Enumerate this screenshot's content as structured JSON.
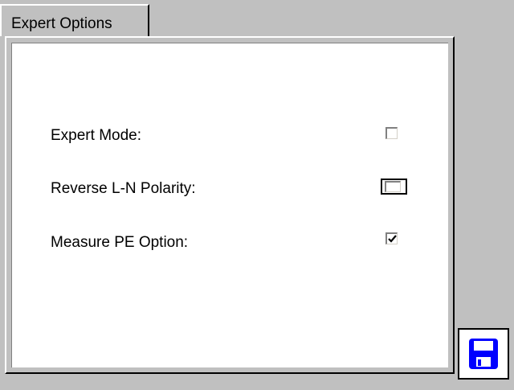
{
  "tab": {
    "label": "Expert Options"
  },
  "options": [
    {
      "label": "Expert Mode:",
      "checked": false,
      "focused": false
    },
    {
      "label": "Reverse L-N Polarity:",
      "checked": false,
      "focused": true
    },
    {
      "label": "Measure PE Option:",
      "checked": true,
      "focused": false
    }
  ],
  "save_button": {
    "icon": "floppy-disk-icon",
    "color": "#0000ff"
  },
  "colors": {
    "background": "#c0c0c0",
    "content": "#ffffff",
    "accent": "#0000ff"
  }
}
